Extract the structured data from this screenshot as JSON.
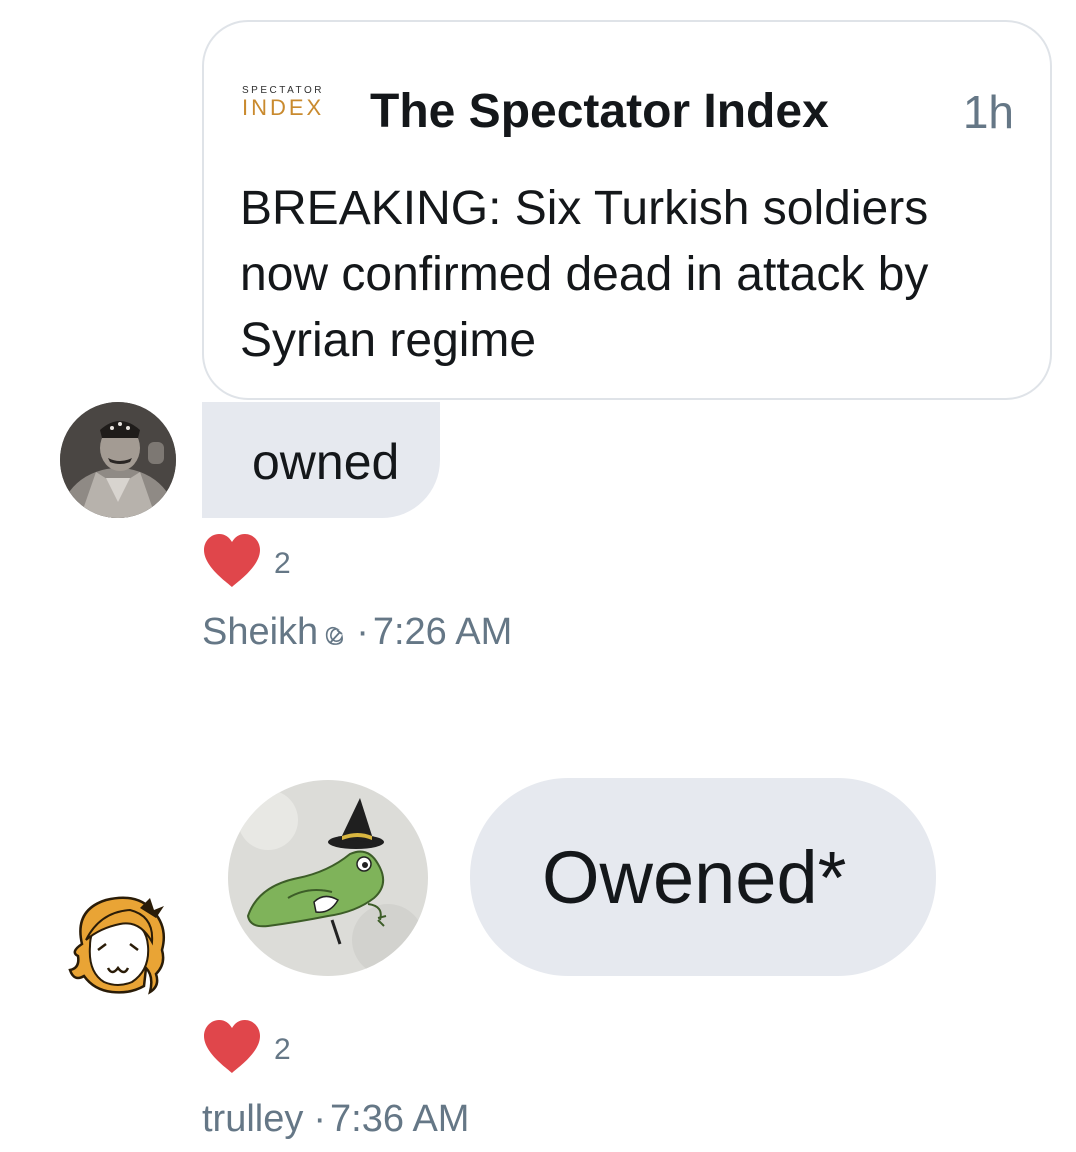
{
  "quote": {
    "brand_top": "SPECTATOR",
    "brand_bottom": "INDEX",
    "author": "The Spectator Index",
    "time": "1h",
    "text": "BREAKING: Six Turkish soldiers now confirmed dead in attack by Syrian regime"
  },
  "messages": [
    {
      "text": "owned",
      "reaction_count": "2",
      "sender": "Sheikh",
      "sender_icon": "hammer-sickle-icon",
      "separator": "·",
      "time": "7:26 AM"
    },
    {
      "text": "Owened*",
      "reaction_count": "2",
      "sender": "trulley",
      "separator": "·",
      "time": "7:36 AM"
    }
  ],
  "colors": {
    "bubble": "#e6e9ef",
    "heart": "#e0464b",
    "meta_text": "#657786",
    "brand_accent": "#c98a2e"
  }
}
